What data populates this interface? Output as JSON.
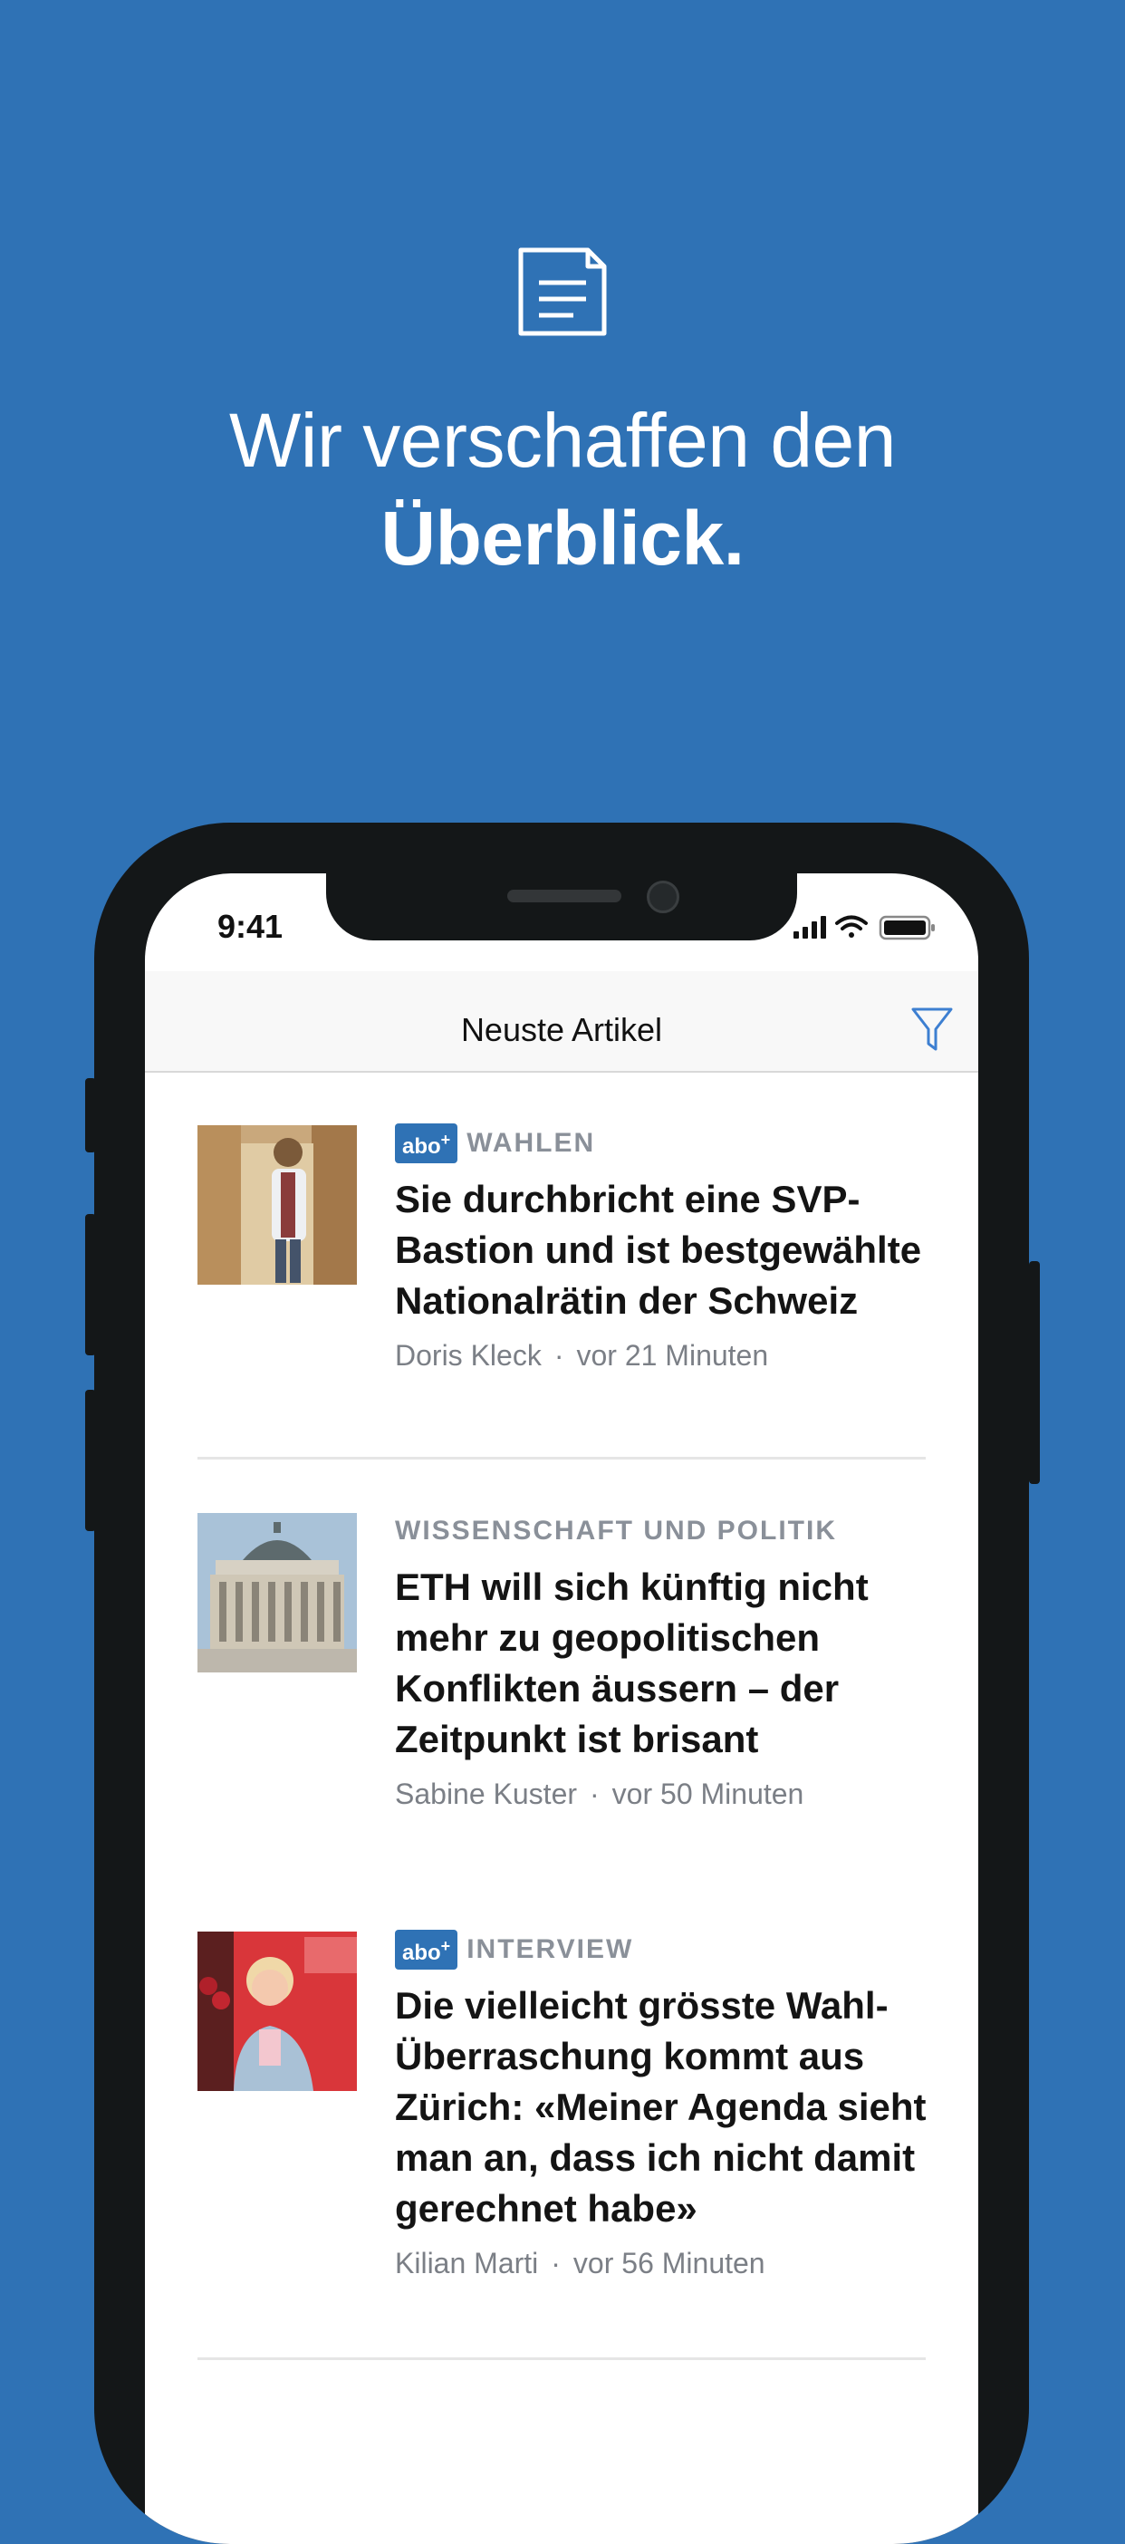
{
  "hero": {
    "icon": "document-icon",
    "headline_line1": "Wir verschaffen den",
    "headline_line2": "Überblick."
  },
  "status_bar": {
    "time": "9:41"
  },
  "navbar": {
    "title": "Neuste Artikel",
    "filter_icon": "filter-icon"
  },
  "articles": [
    {
      "badge": "abo",
      "category": "WAHLEN",
      "title": "Sie durchbricht eine SVP-Bastion und ist bestgewählte Nationalrätin der Schweiz",
      "author": "Doris Kleck",
      "time": "vor 21 Minuten"
    },
    {
      "badge": "",
      "category": "WISSENSCHAFT UND POLITIK",
      "title": "ETH will sich künftig nicht mehr zu geopolitischen Konflikten äussern – der Zeitpunkt ist brisant",
      "author": "Sabine Kuster",
      "time": "vor 50 Minuten"
    },
    {
      "badge": "abo",
      "category": "INTERVIEW",
      "title": "Die vielleicht grösste Wahl-Überraschung kommt aus Zürich: «Meiner Agenda sieht man an, dass ich nicht damit gerechnet habe»",
      "author": "Kilian Marti",
      "time": "vor 56 Minuten"
    }
  ],
  "colors": {
    "background": "#2f72b5",
    "badge": "#2f72b5",
    "filter": "#3d7fd1"
  }
}
